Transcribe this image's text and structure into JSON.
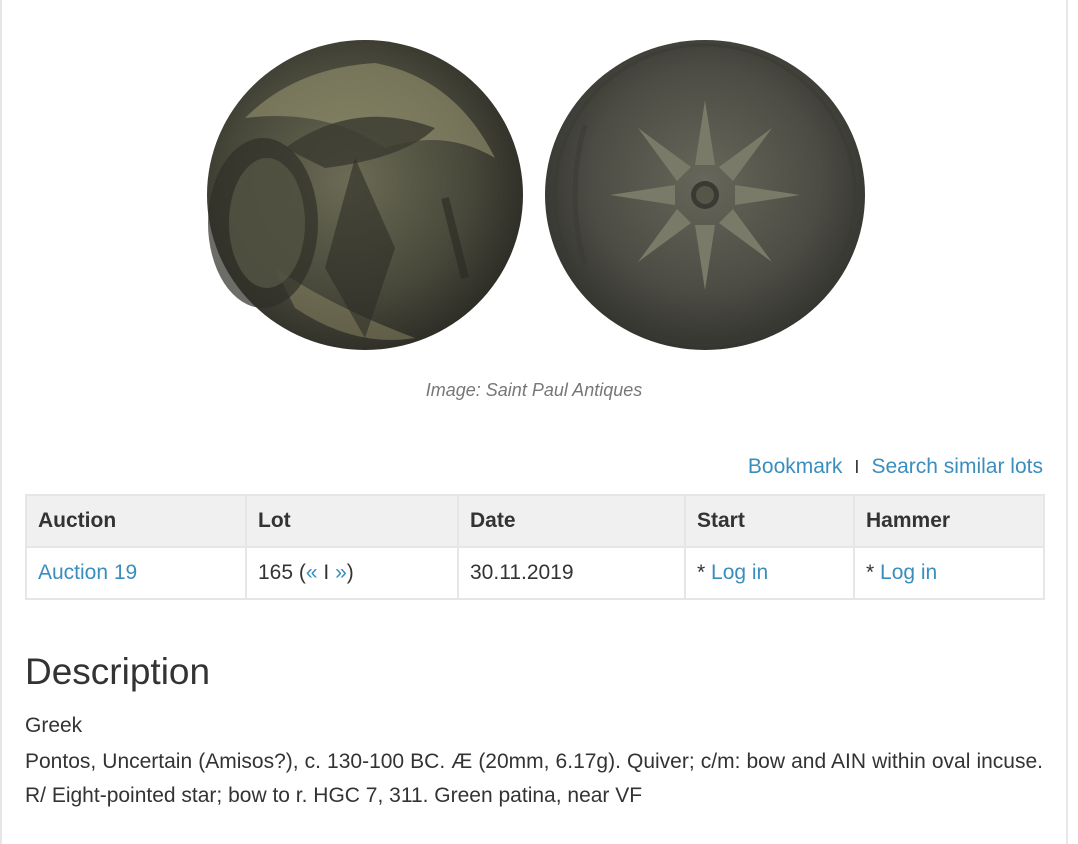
{
  "image": {
    "credit": "Image: Saint Paul Antiques"
  },
  "actions": {
    "bookmark": "Bookmark",
    "separator": "I",
    "search_similar": "Search similar lots"
  },
  "table": {
    "headers": [
      "Auction",
      "Lot",
      "Date",
      "Start",
      "Hammer"
    ],
    "row": {
      "auction": "Auction 19",
      "lot_number": "165",
      "lot_open": " (",
      "prev": "«",
      "lot_sep": " I ",
      "next": "»",
      "lot_close": ")",
      "date": "30.11.2019",
      "start_prefix": "* ",
      "start_link": "Log in",
      "hammer_prefix": "* ",
      "hammer_link": "Log in"
    }
  },
  "description": {
    "heading": "Description",
    "category": "Greek",
    "text": "Pontos, Uncertain (Amisos?), c. 130-100 BC. Æ (20mm, 6.17g). Quiver; c/m: bow and AIN within oval incuse. R/ Eight-pointed star; bow to r. HGC 7, 311. Green patina, near VF"
  },
  "colors": {
    "link": "#3a8ebd",
    "header_bg": "#f0f0f0",
    "border": "#e6e6e6",
    "text": "#333333"
  }
}
